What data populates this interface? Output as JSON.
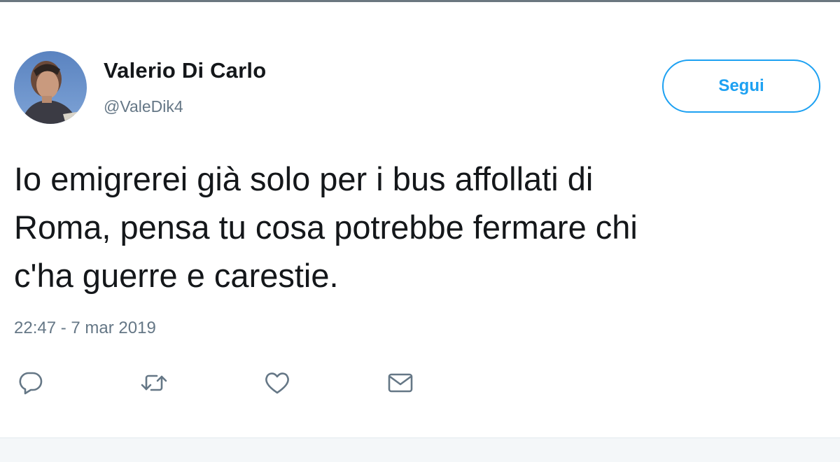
{
  "tweet": {
    "author_name": "Valerio Di Carlo",
    "author_handle": "@ValeDik4",
    "follow_label": "Segui",
    "text": "Io emigrerei già solo per i bus affollati di\nRoma, pensa tu cosa potrebbe fermare chi\nc'ha guerre e carestie.",
    "timestamp": "22:47 - 7 mar 2019"
  },
  "icons": {
    "avatar": "avatar",
    "reply": "reply-icon",
    "retweet": "retweet-icon",
    "like": "heart-icon",
    "message": "envelope-icon"
  },
  "colors": {
    "accent": "#1da1f2",
    "text": "#14171a",
    "muted": "#657786"
  }
}
